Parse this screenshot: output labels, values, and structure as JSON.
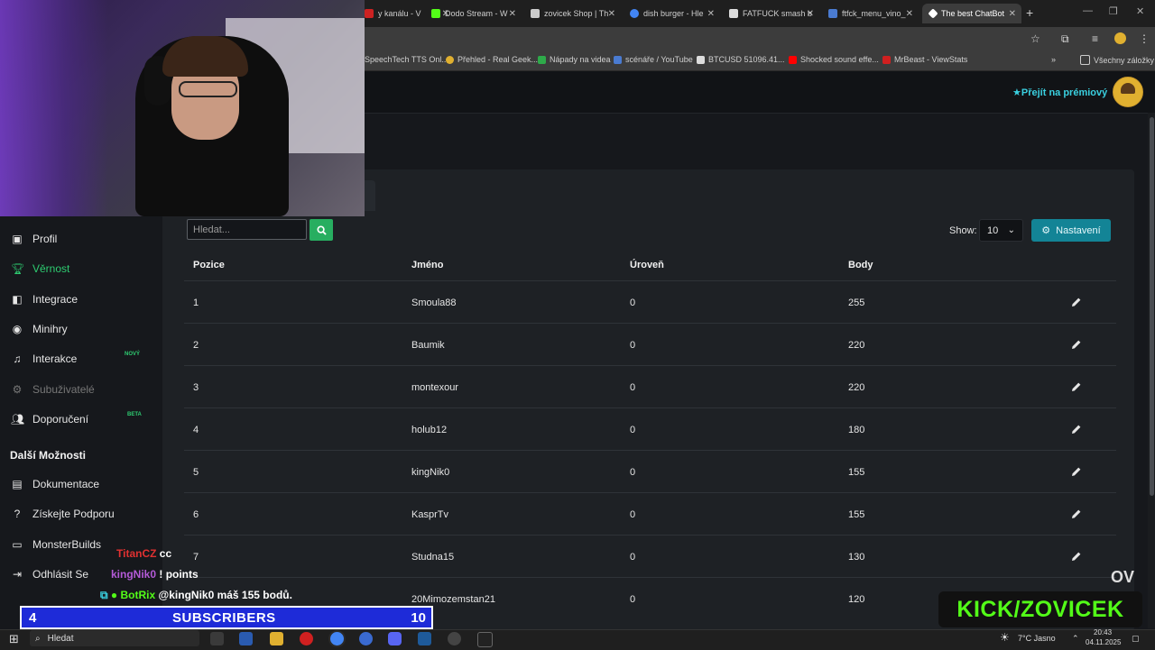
{
  "browser": {
    "tabs": [
      {
        "label": "y kanálu - V",
        "color": "#cc2222"
      },
      {
        "label": "Dodo Stream - W",
        "color": "#53fc18"
      },
      {
        "label": "zovicek Shop | Th",
        "color": "#cccccc"
      },
      {
        "label": "dish burger - Hle",
        "color": "#4285f4"
      },
      {
        "label": "FATFUCK smash b",
        "color": "#dddddd"
      },
      {
        "label": "ftfck_menu_vino_",
        "color": "#4a7bd1"
      },
      {
        "label": "The best ChatBot",
        "color": "#ffffff"
      }
    ],
    "bookmarks": [
      {
        "label": "SpeechTech TTS Onl...",
        "color": "#888888"
      },
      {
        "label": "Přehled - Real Geek...",
        "color": "#e0b030"
      },
      {
        "label": "Nápady na videa",
        "color": "#2eaa4a"
      },
      {
        "label": "scénáře / YouTube",
        "color": "#4a7bd1"
      },
      {
        "label": "BTCUSD 51096.41...",
        "color": "#dddddd"
      },
      {
        "label": "Shocked sound effe...",
        "color": "#ff0000"
      },
      {
        "label": "MrBeast - ViewStats",
        "color": "#d02020"
      }
    ],
    "all_bookmarks": "Všechny záložky"
  },
  "header": {
    "premium_label": "Přejít na prémiový"
  },
  "sidebar": {
    "items": [
      {
        "label": "Profil",
        "icon": "user-icon"
      },
      {
        "label": "Věrnost",
        "icon": "trophy-icon"
      },
      {
        "label": "Integrace",
        "icon": "cube-icon"
      },
      {
        "label": "Minihry",
        "icon": "gamepad-icon"
      },
      {
        "label": "Interakce",
        "icon": "music-icon"
      },
      {
        "label": "Subuživatelé",
        "icon": "gear-icon"
      },
      {
        "label": "Doporučení",
        "icon": "users-icon"
      }
    ],
    "tag_new": "NOVÝ",
    "tag_beta": "BETA",
    "section_title": "Další Možnosti",
    "more_items": [
      {
        "label": "Dokumentace",
        "icon": "book-icon"
      },
      {
        "label": "Získejte Podporu",
        "icon": "help-icon"
      },
      {
        "label": "MonsterBuilds",
        "icon": "monitor-icon"
      },
      {
        "label": "Odhlásit Se",
        "icon": "logout-icon"
      }
    ]
  },
  "toolbar": {
    "search_placeholder": "Hledat...",
    "show_label": "Show:",
    "show_value": "10",
    "settings_label": "Nastavení"
  },
  "table": {
    "headers": [
      "Pozice",
      "Jméno",
      "Úroveň",
      "Body"
    ],
    "rows": [
      {
        "pos": "1",
        "name": "Smoula88",
        "level": "0",
        "points": "255"
      },
      {
        "pos": "2",
        "name": "Baumik",
        "level": "0",
        "points": "220"
      },
      {
        "pos": "3",
        "name": "montexour",
        "level": "0",
        "points": "220"
      },
      {
        "pos": "4",
        "name": "holub12",
        "level": "0",
        "points": "180"
      },
      {
        "pos": "5",
        "name": "kingNik0",
        "level": "0",
        "points": "155"
      },
      {
        "pos": "6",
        "name": "KasprTv",
        "level": "0",
        "points": "155"
      },
      {
        "pos": "7",
        "name": "Studna15",
        "level": "0",
        "points": "130"
      },
      {
        "pos": "",
        "name": "20Mimozemstan21",
        "level": "0",
        "points": "120"
      }
    ]
  },
  "overlay": {
    "chat": [
      {
        "user": "TitanCZ",
        "msg": "cc",
        "user_color": "#e03131"
      },
      {
        "user": "kingNik0",
        "msg": "! points",
        "user_color": "#b45ad8"
      },
      {
        "user": "BotRix",
        "msg": "@kingNik0 máš 155 bodů.",
        "user_color": "#53fc18"
      }
    ],
    "subs_count": "4",
    "subs_label": "SUBSCRIBERS",
    "subs_goal": "10",
    "kick_label": "KICK/ZOVICEK",
    "ov_logo": "OV"
  },
  "taskbar": {
    "search_label": "Hledat",
    "weather": "7°C  Jasno",
    "time": "20:43",
    "date": "04.11.2025"
  }
}
